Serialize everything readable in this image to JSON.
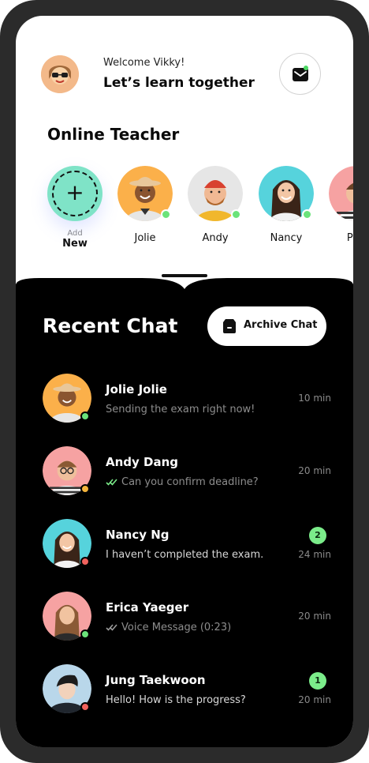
{
  "header": {
    "welcome": "Welcome Vikky!",
    "tagline": "Let’s learn together",
    "mail_icon": "mail-icon"
  },
  "online_teacher": {
    "title": "Online Teacher",
    "add": {
      "small": "Add",
      "label": "New"
    },
    "teachers": [
      {
        "name": "Jolie",
        "bg": "#fbb04a"
      },
      {
        "name": "Andy",
        "bg": "#e6e6e6"
      },
      {
        "name": "Nancy",
        "bg": "#56d3dc"
      },
      {
        "name": "Peri",
        "bg": "#f6a2a2"
      }
    ]
  },
  "recent_chat": {
    "title": "Recent Chat",
    "archive_label": "Archive Chat",
    "chats": [
      {
        "name": "Jolie Jolie",
        "message": "Sending the exam right now!",
        "time": "10 min",
        "read": false,
        "unread": "",
        "status": "#6be37a",
        "bg": "#fbb04a"
      },
      {
        "name": "Andy Dang",
        "message": "Can you confirm deadline?",
        "time": "20 min",
        "read": true,
        "unread": "",
        "status": "#f4b43b",
        "bg": "#f6a2a2"
      },
      {
        "name": "Nancy Ng",
        "message": "I haven’t completed the exam.",
        "time": "24 min",
        "read": false,
        "unread": "2",
        "status": "#f0625d",
        "bg": "#56d3dc"
      },
      {
        "name": "Erica Yaeger",
        "message": "Voice Message (0:23)",
        "time": "20 min",
        "read": true,
        "unread": "",
        "status": "#6be37a",
        "bg": "#f6a2a2"
      },
      {
        "name": "Jung Taekwoon",
        "message": "Hello! How is the progress?",
        "time": "20 min",
        "read": false,
        "unread": "1",
        "status": "#f0625d",
        "bg": "#b9d7ea"
      }
    ]
  },
  "colors": {
    "accent_green": "#7bec8a",
    "add_circle": "#7fe3c7",
    "dark_panel": "#000000",
    "frame": "#2b2b2b"
  }
}
